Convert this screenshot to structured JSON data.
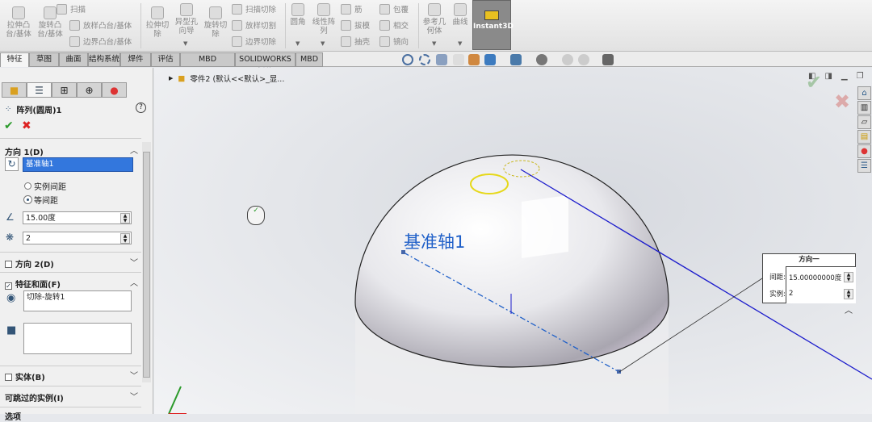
{
  "ribbon": {
    "extrude_boss": "拉伸凸台/基体",
    "revolve_boss": "旋转凸台/基体",
    "sweep": "扫描",
    "loft_boss": "放样凸台/基体",
    "boundary_boss": "边界凸台/基体",
    "extrude_cut": "拉伸切除",
    "hole_wizard": "异型孔向导",
    "revolve_cut": "旋转切除",
    "swept_cut": "扫描切除",
    "lofted_cut": "放样切割",
    "boundary_cut": "边界切除",
    "fillet": "圆角",
    "linear_pattern": "线性阵列",
    "rib": "筋",
    "draft": "拔模",
    "shell": "抽壳",
    "wrap": "包覆",
    "intersect": "相交",
    "mirror": "镜向",
    "ref_geometry": "参考几何体",
    "curves": "曲线",
    "instant3d": "Instant3D"
  },
  "tabs": [
    "特征",
    "草图",
    "曲面",
    "结构系统",
    "焊件",
    "评估",
    "MBD Dimensions",
    "SOLIDWORKS 插件",
    "MBD"
  ],
  "tree": {
    "part": "零件2  (默认<<默认>_显..."
  },
  "panel": {
    "title": "阵列(圆周)1",
    "help": "?",
    "dir1": {
      "header": "方向 1(D)",
      "axis": "基准轴1",
      "radio1": "实例间距",
      "radio2": "等间距",
      "angle": "15.00度",
      "count": "2"
    },
    "dir2": {
      "header": "方向 2(D)"
    },
    "features": {
      "header": "特征和面(F)",
      "item": "切除-旋转1"
    },
    "bodies": {
      "header": "实体(B)"
    },
    "skip": {
      "header": "可跳过的实例(I)"
    },
    "options": {
      "header": "选项"
    }
  },
  "viewport": {
    "axis_label": "基准轴1"
  },
  "callout": {
    "title": "方向一",
    "spacing_label": "间距:",
    "spacing": "15.00000000度",
    "count_label": "实例:",
    "count": "2"
  },
  "colors": {
    "accent": "#1e5fc8",
    "axis_line": "#1c1ccc",
    "selected": "#3377dd",
    "instant3d_bg": "#8a8a8a"
  }
}
